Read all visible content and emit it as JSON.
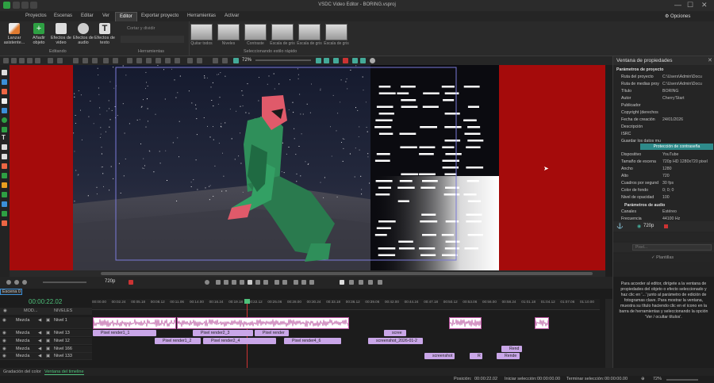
{
  "window": {
    "title": "VSDC Video Editor - BORING.vsproj",
    "options_label": "Opciones"
  },
  "menu": [
    "Proyectos",
    "Escenas",
    "Editar",
    "Ver",
    "Editor",
    "Exportar proyecto",
    "Herramientas",
    "Activar"
  ],
  "menu_active": "Editor",
  "ribbon": {
    "buttons": [
      {
        "label": "Lanzar asistente...",
        "icon": "wand-icon"
      },
      {
        "label": "Añadir objeto",
        "icon": "add-object-icon"
      },
      {
        "label": "Efectos de video",
        "icon": "video-effects-icon"
      },
      {
        "label": "Efectos de audio",
        "icon": "audio-effects-icon"
      },
      {
        "label": "Efectos de texto",
        "icon": "text-effects-icon"
      }
    ],
    "editing_group_label": "Editando",
    "tools_group_label": "Herramientas",
    "tools": [
      "Cortar y dividir"
    ],
    "quick_style_label": "Seleccionando estilo rápido",
    "quick_styles": [
      "Quitar todos",
      "Niveles",
      "Contraste",
      "Escala de gris",
      "Escala de gris",
      "Escala de gris"
    ]
  },
  "zoom_percent": "72%",
  "properties": {
    "panel_title": "Ventana de propiedades",
    "section_project": "Parámetros de proyecto",
    "rows": [
      {
        "k": "Ruta del proyecto",
        "v": "C:\\Users\\Admin\\Docu"
      },
      {
        "k": "Ruta de medias proy",
        "v": "C:\\Users\\Admin\\Docu"
      },
      {
        "k": "Título",
        "v": "BORING"
      },
      {
        "k": "Autor",
        "v": "Cherry'Start"
      },
      {
        "k": "Publicador",
        "v": ""
      },
      {
        "k": "Copyright (derechos",
        "v": ""
      },
      {
        "k": "Fecha de creación",
        "v": "24/01/2026"
      },
      {
        "k": "Descripción",
        "v": ""
      },
      {
        "k": "ISRC",
        "v": ""
      },
      {
        "k": "Guardar los datos mu",
        "v": ""
      }
    ],
    "protection_button": "Protección de contraseña",
    "rows2": [
      {
        "k": "Dispositivo",
        "v": "YouTube"
      },
      {
        "k": "Tamaño de escena",
        "v": "720p HD 1280x720 pixel"
      },
      {
        "k": "Ancho",
        "v": "1280"
      },
      {
        "k": "Alto",
        "v": "720"
      },
      {
        "k": "Cuadros por segund",
        "v": "30 fps"
      },
      {
        "k": "Color de fondo",
        "v": "0; 0; 0"
      },
      {
        "k": "Nivel de opacidad",
        "v": "100"
      }
    ],
    "section_audio": "Parámetros de audio",
    "rows3": [
      {
        "k": "Canales",
        "v": "Estéreo"
      },
      {
        "k": "Frecuencia",
        "v": "44100 Hz"
      }
    ],
    "resolution_label": "720p",
    "filter_placeholder": "Pixel...",
    "templates_label": "Plantillas"
  },
  "player": {
    "resolution": "720p"
  },
  "timeline": {
    "scene_tab": "Escena 0",
    "current_time": "00:00:22.02",
    "header_mode": "MOD...",
    "header_levels": "NIVELES",
    "ruler": [
      "00:00.00",
      "00:02.24",
      "00:05.18",
      "00:08.12",
      "00:11.06",
      "00:14.00",
      "00:16.24",
      "00:19.18",
      "00:22.12",
      "00:25.06",
      "00:28.00",
      "00:30.24",
      "00:33.18",
      "00:36.12",
      "00:39.06",
      "00:42.00",
      "00:44.24",
      "00:47.18",
      "00:50.12",
      "00:53.06",
      "00:56.00",
      "00:58.24",
      "01:01.18",
      "01:04.12",
      "01:07.06",
      "01:10.00"
    ],
    "tracks": [
      {
        "mode": "Mezcla",
        "level": "Nivel 1"
      },
      {
        "mode": "Mezcla",
        "level": "Nivel 13"
      },
      {
        "mode": "Mezcla",
        "level": "Nivel 12"
      },
      {
        "mode": "Mezcla",
        "level": "Nivel 166"
      },
      {
        "mode": "Mezcla",
        "level": "Nivel 133"
      }
    ],
    "clips": {
      "pr1_1": "Pixel render1_1",
      "pr2_3": "Pixel render2_3",
      "prender": "Pixel render",
      "screen": "scree",
      "pr1_2": "Pixel render1_2",
      "pr2_4": "Pixel render2_4",
      "pr4_6": "Pixel render4_6",
      "screenshot_long": "screenshot_2026-01-2",
      "rend": "Rend",
      "screenshot": "screenshot",
      "r": "R",
      "rende": "Rende"
    }
  },
  "help_text": "Para acceder al editor, dirígete a la ventana de propiedades del objeto o efecto seleccionado y haz clic en '...' junto al parámetro de edición de fotogramas clave. Para mostrar la ventana, muestra su título haciendo clic en el icono en la barra de herramientas y seleccionando la opción 'Ver / ocultar títulos'.",
  "bottom_tabs": [
    "Gradación del color",
    "Ventana del timeline"
  ],
  "status": {
    "position_label": "Posición:",
    "position": "00:00:22.02",
    "start_label": "Iniciar selección:",
    "start": "00:00:00.00",
    "end_label": "Terminar selección:",
    "end": "00:00:00.00",
    "zoom": "72%"
  },
  "colors": {
    "accent": "#2ea043",
    "clip_purple": "#c9a6e8",
    "audio_wave": "#b9529f",
    "scene_red": "#a50b0b"
  }
}
